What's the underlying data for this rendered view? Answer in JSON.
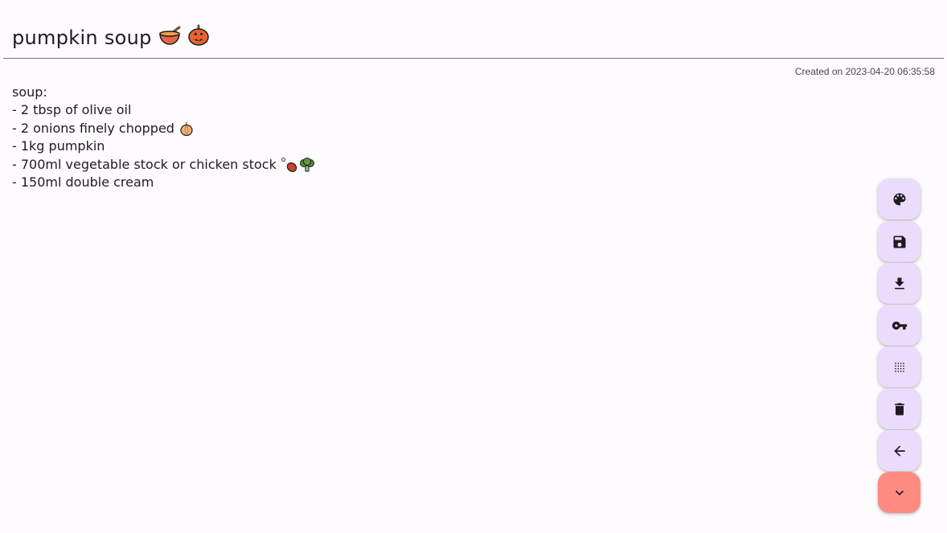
{
  "note": {
    "title": "pumpkin soup",
    "title_emojis": [
      "bowl-with-spoon",
      "jack-o-lantern"
    ],
    "created_label": "Created on 2023-04-20 06:35:58",
    "lines": [
      "soup:",
      "- 2 tbsp of olive oil",
      "- 2 onions finely chopped",
      "- 1kg pumpkin",
      "- 700ml vegetable stock or chicken stock",
      "- 150ml double cream"
    ],
    "line_emojis": {
      "2": [
        "onion"
      ],
      "4": [
        "poultry-leg",
        "broccoli"
      ]
    }
  },
  "actions": [
    {
      "name": "palette-button",
      "icon": "palette-icon"
    },
    {
      "name": "save-button",
      "icon": "save-icon"
    },
    {
      "name": "download-button",
      "icon": "download-icon"
    },
    {
      "name": "key-button",
      "icon": "key-icon"
    },
    {
      "name": "grid-button",
      "icon": "dots-grid-icon"
    },
    {
      "name": "delete-button",
      "icon": "trash-icon"
    },
    {
      "name": "back-button",
      "icon": "arrow-left-icon"
    },
    {
      "name": "collapse-button",
      "icon": "chevron-down-icon"
    }
  ],
  "colors": {
    "background": "#fdfbfd",
    "fab": "#ebdcfb",
    "fab_accent": "#ff8a80",
    "icon": "#1f1b20"
  }
}
